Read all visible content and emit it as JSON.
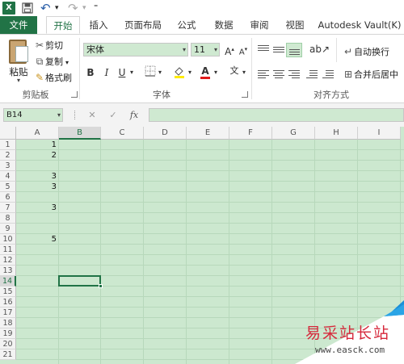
{
  "app": {
    "logo_letter": "X"
  },
  "qat": {
    "undo_symbol": "↶",
    "redo_symbol": "↷",
    "dd": "▾",
    "qat_dd": "⁼"
  },
  "tabs": [
    {
      "label": "文件"
    },
    {
      "label": "开始"
    },
    {
      "label": "插入"
    },
    {
      "label": "页面布局"
    },
    {
      "label": "公式"
    },
    {
      "label": "数据"
    },
    {
      "label": "审阅"
    },
    {
      "label": "视图"
    },
    {
      "label": "Autodesk Vault(K)"
    }
  ],
  "clipboard": {
    "paste_label": "粘贴",
    "paste_arrow": "▾",
    "cut_label": "剪切",
    "copy_label": "复制",
    "format_painter_label": "格式刷",
    "group_label": "剪贴板"
  },
  "font": {
    "name": "宋体",
    "size": "11",
    "grow": "A",
    "shrink": "A",
    "bold": "B",
    "italic": "I",
    "underline": "U",
    "wen": "文",
    "group_label": "字体"
  },
  "alignment": {
    "wrap_text_label": "自动换行",
    "merge_center_label": "合并后居中",
    "group_label": "对齐方式"
  },
  "formula_bar": {
    "name_box": "B14",
    "fx": "fx",
    "cancel": "✕",
    "enter": "✓"
  },
  "grid": {
    "columns": [
      "A",
      "B",
      "C",
      "D",
      "E",
      "F",
      "G",
      "H",
      "I"
    ],
    "rows": [
      "1",
      "2",
      "3",
      "4",
      "5",
      "6",
      "7",
      "8",
      "9",
      "10",
      "11",
      "12",
      "13",
      "14",
      "15",
      "16",
      "17",
      "18",
      "19",
      "20",
      "21"
    ],
    "selected_cell": "B14",
    "values": {
      "A1": "1",
      "A2": "2",
      "A4": "3",
      "A5": "3",
      "A7": "3",
      "A10": "5"
    }
  },
  "watermark": {
    "text": "易采站长站",
    "url": "www.easck.com"
  },
  "colors": {
    "excel_green": "#217346",
    "sheet_tint": "#cce8cf",
    "watermark_red": "#d6283b",
    "watermark_blue": "#1a8fd8"
  }
}
